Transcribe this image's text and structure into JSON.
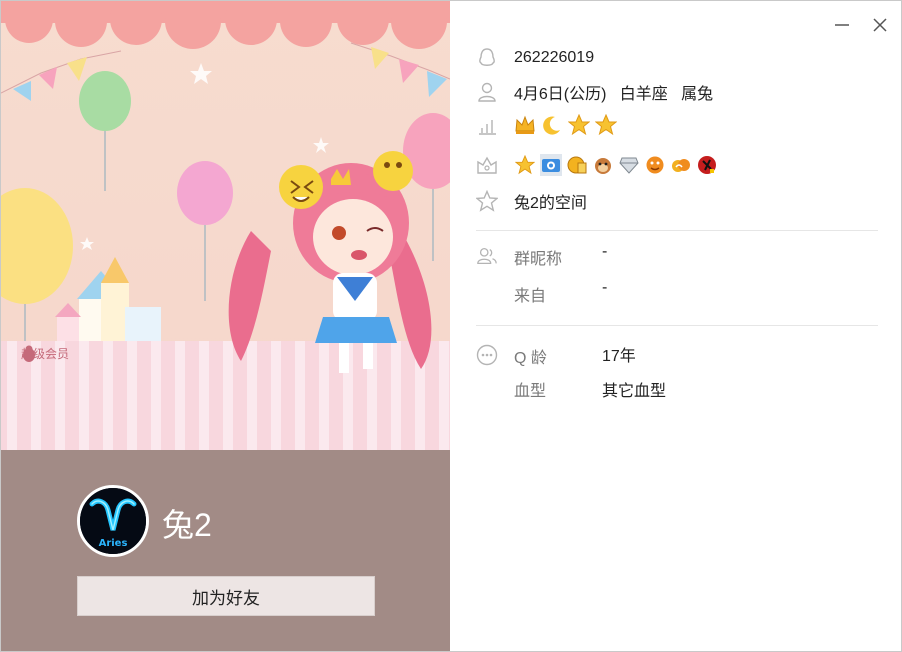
{
  "window": {
    "minimize_icon": "minimize-icon",
    "close_icon": "close-icon"
  },
  "cover": {
    "vip_label": "超级会员"
  },
  "profile": {
    "nickname": "兔2",
    "avatar_text": "Aries",
    "add_friend_label": "加为好友"
  },
  "info": {
    "qq_number": "262226019",
    "birthday_line": "4月6日(公历)   白羊座   属兔",
    "level_icons": [
      "crown-icon",
      "moon-icon",
      "star-icon",
      "star-icon"
    ],
    "service_icons": [
      "yellow-star-icon",
      "camera-icon",
      "gold-medal-icon",
      "monkey-icon",
      "diamond-icon",
      "orange-face-icon",
      "orange-cloud-icon",
      "red-figure-icon"
    ],
    "space_link": "兔2的空间"
  },
  "group": {
    "nickname_label": "群昵称",
    "nickname_value": "-",
    "from_label": "来自",
    "from_value": "-"
  },
  "more": {
    "qage_label": "Q 龄",
    "qage_value": "17年",
    "blood_label": "血型",
    "blood_value": "其它血型"
  },
  "colors": {
    "band": "#a28b86",
    "button_bg": "#ede5e4",
    "icon_gray": "#b4b4b4"
  }
}
